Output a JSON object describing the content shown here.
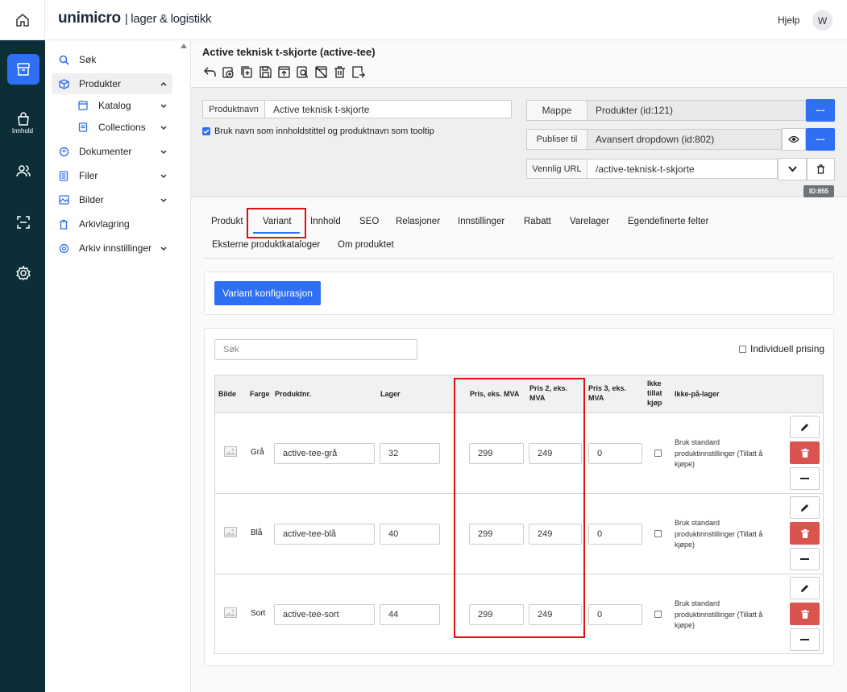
{
  "app": {
    "logo_brand": "unimicro",
    "logo_sub": "| lager & logistikk",
    "help": "Hjelp",
    "avatar": "W"
  },
  "rail": {
    "active_label": "Innhold"
  },
  "sidebar": {
    "items": [
      {
        "label": "Søk",
        "icon": "search-icon"
      },
      {
        "label": "Produkter",
        "icon": "box-icon"
      },
      {
        "label": "Katalog",
        "icon": "catalog-icon"
      },
      {
        "label": "Collections",
        "icon": "collections-icon"
      },
      {
        "label": "Dokumenter",
        "icon": "document-icon"
      },
      {
        "label": "Filer",
        "icon": "file-icon"
      },
      {
        "label": "Bilder",
        "icon": "image-icon"
      },
      {
        "label": "Arkivlagring",
        "icon": "trash-icon"
      },
      {
        "label": "Arkiv innstillinger",
        "icon": "gear-icon"
      }
    ]
  },
  "page": {
    "title": "Active teknisk t-skjorte (active-tee)"
  },
  "header": {
    "productname_label": "Produktnavn",
    "productname_value": "Active teknisk t-skjorte",
    "tooltip_checkbox_label": "Bruk navn som innholdstittel og produktnavn som tooltip",
    "folder_label": "Mappe",
    "folder_value": "Produkter (id:121)",
    "publish_label": "Publiser til",
    "publish_value": "Avansert dropdown (id:802)",
    "url_label": "Vennlig URL",
    "url_value": "/active-teknisk-t-skjorte",
    "more": "---",
    "id_badge": "ID:855"
  },
  "tabs": [
    "Produkt",
    "Variant",
    "Innhold",
    "SEO",
    "Relasjoner",
    "Innstillinger",
    "Rabatt",
    "Varelager",
    "Egendefinerte felter",
    "Eksterne produktkataloger",
    "Om produktet"
  ],
  "variant": {
    "config_button": "Variant konfigurasjon",
    "search_placeholder": "Søk",
    "individual_pricing": "Individuell prising",
    "columns": {
      "image": "Bilde",
      "color": "Farge",
      "sku": "Produktnr.",
      "stock": "Lager",
      "price1": "Pris, eks. MVA",
      "price2": "Pris 2, eks. MVA",
      "price3": "Pris 3, eks. MVA",
      "nobuy": "Ikke tillat kjøp",
      "outofstock": "Ikke-på-lager"
    },
    "rows": [
      {
        "color": "Grå",
        "sku": "active-tee-grå",
        "stock": "32",
        "price1": "299",
        "price2": "249",
        "price3": "0",
        "note": "Bruk standard produktinnstillinger (Tillatt å kjøpe)"
      },
      {
        "color": "Blå",
        "sku": "active-tee-blå",
        "stock": "40",
        "price1": "299",
        "price2": "249",
        "price3": "0",
        "note": "Bruk standard produktinnstillinger (Tillatt å kjøpe)"
      },
      {
        "color": "Sort",
        "sku": "active-tee-sort",
        "stock": "44",
        "price1": "299",
        "price2": "249",
        "price3": "0",
        "note": "Bruk standard produktinnstillinger (Tillatt å kjøpe)"
      }
    ]
  },
  "colors": {
    "accent": "#2f6ff3",
    "rail": "#0c2e36",
    "danger": "#d9534f",
    "highlight": "#dd1111"
  }
}
